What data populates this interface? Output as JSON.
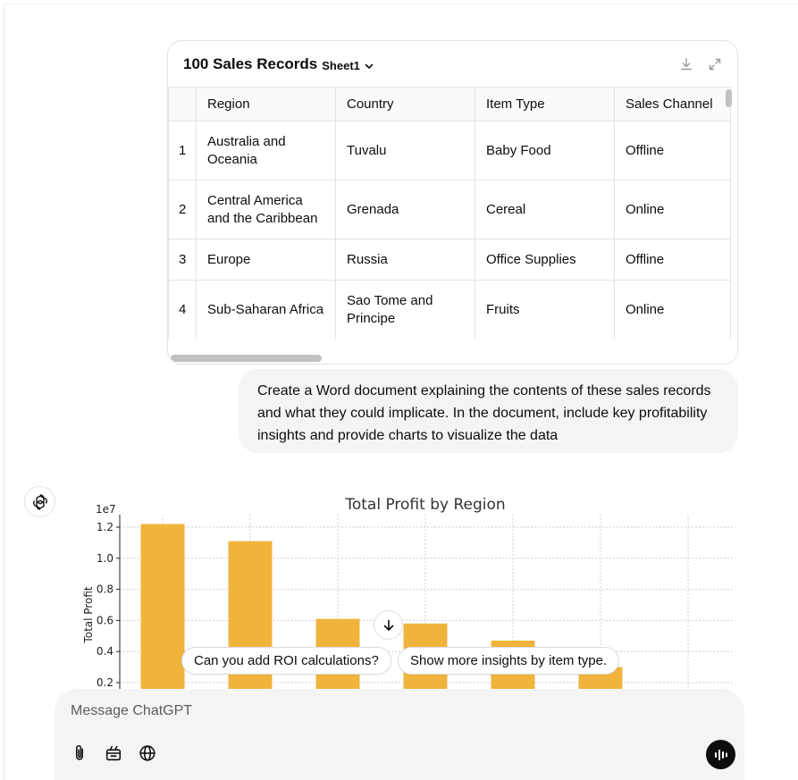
{
  "sheet": {
    "title": "100 Sales Records",
    "tab_label": "Sheet1",
    "download_icon": "download-icon",
    "expand_icon": "expand-icon",
    "columns": [
      "Region",
      "Country",
      "Item Type",
      "Sales Channel"
    ],
    "rows": [
      {
        "num": "1",
        "region": "Australia and Oceania",
        "country": "Tuvalu",
        "item_type": "Baby Food",
        "channel": "Offline"
      },
      {
        "num": "2",
        "region": "Central America and the Caribbean",
        "country": "Grenada",
        "item_type": "Cereal",
        "channel": "Online"
      },
      {
        "num": "3",
        "region": "Europe",
        "country": "Russia",
        "item_type": "Office Supplies",
        "channel": "Offline"
      },
      {
        "num": "4",
        "region": "Sub-Saharan Africa",
        "country": "Sao Tome and Principe",
        "item_type": "Fruits",
        "channel": "Online"
      }
    ]
  },
  "user_message": "Create a Word document explaining the contents of these sales records and what they could implicate. In the document, include key profitability insights and provide charts to visualize the data",
  "chart_data": {
    "type": "bar",
    "title": "Total Profit by Region",
    "ylabel": "Total Profit",
    "xlabel": "",
    "offset_label": "1e7",
    "yticks": [
      "0.2",
      "0.4",
      "0.6",
      "0.8",
      "1.0",
      "1.2"
    ],
    "ylim": [
      0,
      1.28
    ],
    "series": [
      {
        "values": [
          1.22,
          1.11,
          0.61,
          0.58,
          0.47,
          0.3,
          0
        ]
      }
    ],
    "bar_color": "#f0b43c",
    "grid": true
  },
  "suggestions": [
    "Can you add ROI calculations?",
    "Show more insights by item type."
  ],
  "composer": {
    "placeholder": "Message ChatGPT"
  }
}
